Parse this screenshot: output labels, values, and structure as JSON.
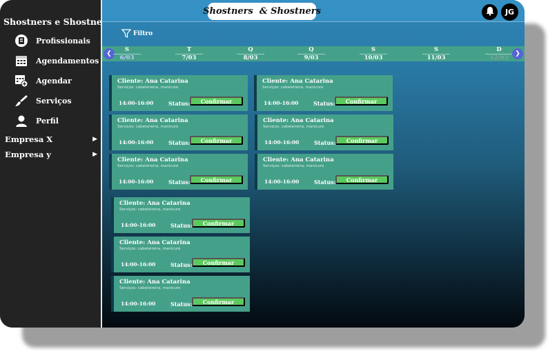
{
  "app": {
    "title": "Shostners  & Shostners"
  },
  "sidebar": {
    "brand": "Shostners e Shostners",
    "items": [
      {
        "label": "Profissionais",
        "icon": "professional-badge-icon"
      },
      {
        "label": "Agendamentos",
        "icon": "calendar-icon"
      },
      {
        "label": "Agendar",
        "icon": "add-calendar-icon"
      },
      {
        "label": "Serviços",
        "icon": "brush-icon"
      },
      {
        "label": "Perfil",
        "icon": "user-icon"
      }
    ],
    "companies": [
      {
        "label": "Empresa X"
      },
      {
        "label": "Empresa y"
      }
    ]
  },
  "header": {
    "notification_icon": "bell-icon",
    "avatar_initials": "JG"
  },
  "filter": {
    "label": "Filtro",
    "icon": "filter-icon"
  },
  "calendar": {
    "days": [
      {
        "weekday": "S",
        "date": "6/03"
      },
      {
        "weekday": "T",
        "date": "7/03"
      },
      {
        "weekday": "Q",
        "date": "8/03"
      },
      {
        "weekday": "Q",
        "date": "9/03"
      },
      {
        "weekday": "S",
        "date": "10/03"
      },
      {
        "weekday": "S",
        "date": "11/03"
      },
      {
        "weekday": "D",
        "date": "12/03"
      }
    ],
    "selected_date": "6/03",
    "prev_icon": "chevron-left-icon",
    "next_icon": "chevron-right-icon"
  },
  "appointments": [
    {
      "client": "Cliente: Ana Catarina",
      "services": "Serviços: cabeleireira, manicure",
      "time": "14:00-16:00",
      "status_label": "Status:",
      "action": "Confirmar"
    },
    {
      "client": "Cliente: Ana Catarina",
      "services": "Serviços: cabeleireira, manicure",
      "time": "14:00-16:00",
      "status_label": "Status:",
      "action": "Confirmar"
    },
    {
      "client": "Cliente: Ana Catarina",
      "services": "Serviços: cabeleireira, manicure",
      "time": "14:00-16:00",
      "status_label": "Status:",
      "action": "Confirmar"
    },
    {
      "client": "Cliente: Ana Catarina",
      "services": "Serviços: cabeleireira, manicure",
      "time": "14:00-16:00",
      "status_label": "Status:",
      "action": "Confirmar"
    },
    {
      "client": "Cliente: Ana Catarina",
      "services": "Serviços: cabeleireira, manicure",
      "time": "14:00-16:00",
      "status_label": "Status:",
      "action": "Confirmar"
    },
    {
      "client": "Cliente: Ana Catarina",
      "services": "Serviços: cabeleireira, manicure",
      "time": "14:00-16:00",
      "status_label": "Status:",
      "action": "Confirmar"
    },
    {
      "client": "Cliente: Ana Catarina",
      "services": "Serviços: cabeleireira, manicure",
      "time": "14:00-16:00",
      "status_label": "Status:",
      "action": "Confirmar"
    },
    {
      "client": "Cliente: Ana Catarina",
      "services": "Serviços: cabeleireira, manicure",
      "time": "14:00-16:00",
      "status_label": "Status:",
      "action": "Confirmar"
    },
    {
      "client": "Cliente: Ana Catarina",
      "services": "Serviços: cabeleireira, manicure",
      "time": "14:00-16:00",
      "status_label": "Status:",
      "action": "Confirmar"
    }
  ],
  "colors": {
    "sidebar": "#232323",
    "topbar": "#3590c4",
    "card": "#45a08a",
    "confirm_button": "#5cc95e",
    "calendar_nav": "#5564d6"
  }
}
